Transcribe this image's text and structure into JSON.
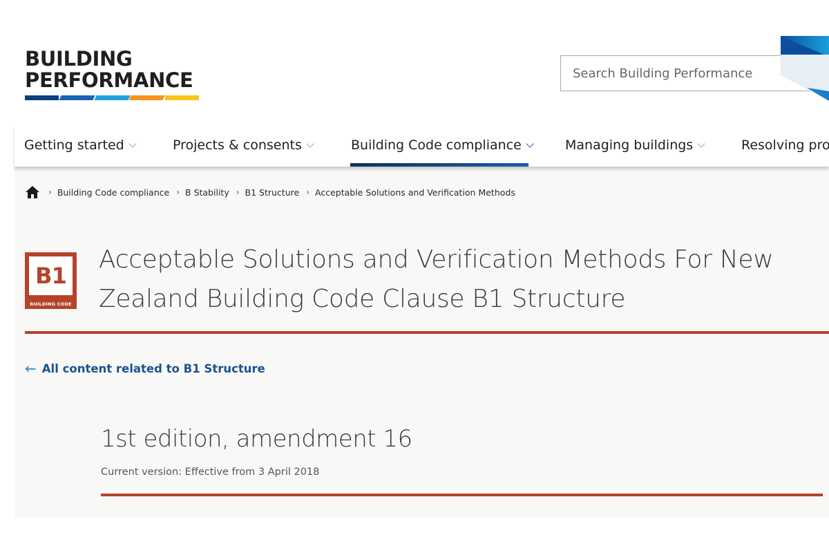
{
  "header": {
    "logo_lines": [
      "BUILDING",
      "PERFORMANCE"
    ],
    "logo_bar_colors": [
      "#0b3f7e",
      "#1766b4",
      "#23a0dc",
      "#f7941d",
      "#fcc419"
    ],
    "search": {
      "placeholder": "Search Building Performance",
      "value": ""
    }
  },
  "nav": {
    "items": [
      {
        "label": "Getting started",
        "has_dropdown": true,
        "active": false
      },
      {
        "label": "Projects & consents",
        "has_dropdown": true,
        "active": false
      },
      {
        "label": "Building Code compliance",
        "has_dropdown": true,
        "active": true
      },
      {
        "label": "Managing buildings",
        "has_dropdown": true,
        "active": false
      },
      {
        "label": "Resolving pro",
        "has_dropdown": false,
        "active": false
      }
    ]
  },
  "breadcrumb": {
    "home_icon": "home-icon",
    "items": [
      "Building Code compliance",
      "B Stability",
      "B1 Structure",
      "Acceptable Solutions and Verification Methods"
    ]
  },
  "badge": {
    "code": "B1",
    "label": "BUILDING CODE",
    "color": "#b5432a"
  },
  "page": {
    "title_line1": "Acceptable Solutions and Verification Methods For New",
    "title_line2": "Zealand Building Code Clause B1 Structure",
    "back_link": "All content related to B1 Structure",
    "back_icon": "arrow-left-icon",
    "edition": "1st edition, amendment 16",
    "version": "Current version: Effective from 3 April 2018"
  },
  "colors": {
    "accent_rule": "#b5432a",
    "link": "#1b5390",
    "nav_active": "#10305c"
  }
}
